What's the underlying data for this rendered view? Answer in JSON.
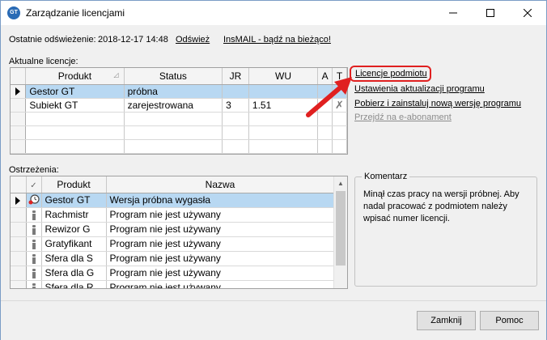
{
  "window": {
    "title": "Zarządzanie licencjami",
    "icon_name": "app-logo-icon",
    "controls": [
      "minimize-icon",
      "maximize-icon",
      "close-icon"
    ]
  },
  "top": {
    "refresh_label": "Ostatnie odświeżenie:",
    "refresh_value": "2018-12-17 14:48",
    "refresh_link": "Odśwież",
    "insmail_link": "InsMAIL - bądź na bieżąco!"
  },
  "licenses": {
    "label": "Aktualne licencje:",
    "columns": [
      "Produkt",
      "Status",
      "JR",
      "WU",
      "A",
      "T"
    ],
    "rows": [
      {
        "product": "Gestor GT",
        "status": "próbna",
        "jr": "",
        "wu": "",
        "a": "",
        "t": ""
      },
      {
        "product": "Subiekt GT",
        "status": "zarejestrowana",
        "jr": "3",
        "wu": "1.51",
        "a": "",
        "t": ""
      }
    ],
    "selected_row": 0
  },
  "actions": {
    "items": [
      {
        "label": "Licencje podmiotu",
        "enabled": true,
        "highlighted": true
      },
      {
        "label": "Ustawienia aktualizacji programu",
        "enabled": true
      },
      {
        "label": "Pobierz i zainstaluj nową wersję programu",
        "enabled": true
      },
      {
        "label": "Przejdź na e-abonament",
        "enabled": false
      }
    ],
    "highlight_color": "#e02020"
  },
  "warnings": {
    "label": "Ostrzeżenia:",
    "columns": [
      "",
      "Produkt",
      "Nazwa"
    ],
    "rows": [
      {
        "icon": "warning-clock-icon",
        "product": "Gestor GT",
        "name": "Wersja próbna wygasła"
      },
      {
        "icon": "info-icon",
        "product": "Rachmistr",
        "name": "Program nie jest używany"
      },
      {
        "icon": "info-icon",
        "product": "Rewizor G",
        "name": "Program nie jest używany"
      },
      {
        "icon": "info-icon",
        "product": "Gratyfikant",
        "name": "Program nie jest używany"
      },
      {
        "icon": "info-icon",
        "product": "Sfera dla S",
        "name": "Program nie jest używany"
      },
      {
        "icon": "info-icon",
        "product": "Sfera dla G",
        "name": "Program nie jest używany"
      },
      {
        "icon": "info-icon",
        "product": "Sfera dla R",
        "name": "Program nie jest używany"
      }
    ],
    "selected_row": 0
  },
  "comment": {
    "title": "Komentarz",
    "text": "Minął czas pracy na wersji próbnej. Aby nadal pracować z podmiotem należy wpisać numer licencji."
  },
  "buttons": {
    "close": "Zamknij",
    "help": "Pomoc"
  },
  "colors": {
    "selection": "#b8d8f2",
    "annotation_arrow": "#e02020"
  }
}
